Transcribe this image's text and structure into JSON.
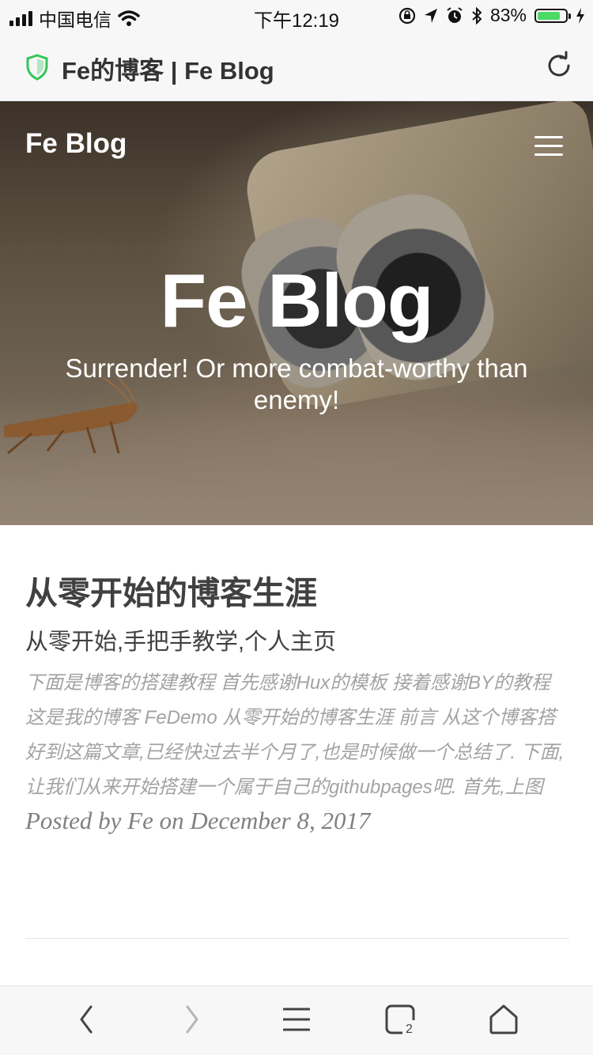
{
  "status_bar": {
    "carrier": "中国电信",
    "time": "下午12:19",
    "battery_percent": "83%",
    "battery_level": 0.83,
    "battery_color": "#4cd964"
  },
  "browser": {
    "page_title": "Fe的博客 | Fe Blog",
    "shield_color": "#34c759"
  },
  "hero": {
    "brand": "Fe Blog",
    "title": "Fe Blog",
    "subtitle": "Surrender! Or more combat-worthy than enemy!"
  },
  "post": {
    "title": "从零开始的博客生涯",
    "subtitle": "从零开始,手把手教学,个人主页",
    "excerpt": "下面是博客的搭建教程 首先感谢Hux的模板 接着感谢BY的教程 这是我的博客 FeDemo 从零开始的博客生涯 前言 从这个博客搭好到这篇文章,已经快过去半个月了,也是时候做一个总结了. 下面,让我们从来开始搭建一个属于自己的githubpages吧. 首先,上图",
    "meta": "Posted by Fe on December 8, 2017"
  },
  "toolbar": {
    "tab_count": "2"
  }
}
